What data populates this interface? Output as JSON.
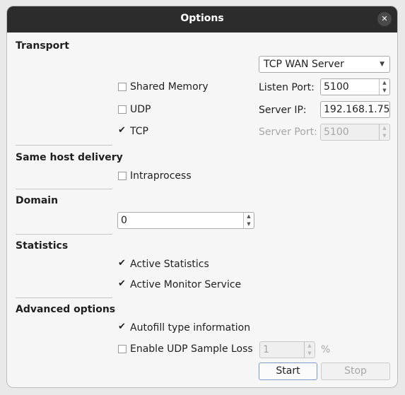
{
  "window": {
    "title": "Options"
  },
  "transport": {
    "heading": "Transport",
    "mode_select": "TCP WAN Server",
    "shared_memory": {
      "label": "Shared Memory",
      "checked": false
    },
    "udp": {
      "label": "UDP",
      "checked": false
    },
    "tcp": {
      "label": "TCP",
      "checked": true
    },
    "listen_port": {
      "label": "Listen Port:",
      "value": "5100"
    },
    "server_ip": {
      "label": "Server IP:",
      "value": "192.168.1.75"
    },
    "server_port": {
      "label": "Server Port:",
      "value": "5100",
      "enabled": false
    }
  },
  "same_host": {
    "heading": "Same host delivery",
    "intraprocess": {
      "label": "Intraprocess",
      "checked": false
    }
  },
  "domain": {
    "heading": "Domain",
    "value": "0"
  },
  "statistics": {
    "heading": "Statistics",
    "active_statistics": {
      "label": "Active Statistics",
      "checked": true
    },
    "active_monitor": {
      "label": "Active Monitor Service",
      "checked": true
    }
  },
  "advanced": {
    "heading": "Advanced options",
    "autofill": {
      "label": "Autofill type information",
      "checked": true
    },
    "udp_sample_loss": {
      "label": "Enable UDP Sample Loss",
      "checked": false
    },
    "loss_value": "1",
    "loss_unit": "%"
  },
  "buttons": {
    "start": "Start",
    "stop": "Stop"
  },
  "icons": {
    "close": "close-icon",
    "check": "checkmark-icon",
    "dropdown": "chevron-down-icon"
  }
}
